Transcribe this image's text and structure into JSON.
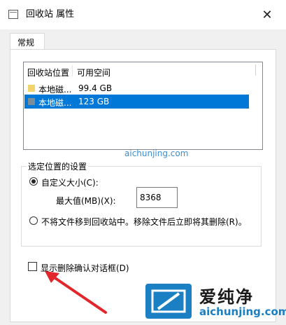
{
  "window": {
    "title": "回收站 属性",
    "close_glyph": "✕"
  },
  "tabs": [
    {
      "label": "常规"
    }
  ],
  "list": {
    "headers": [
      "回收站位置",
      "可用空间"
    ],
    "rows": [
      {
        "location": "本地磁...",
        "free": "99.4 GB",
        "selected": false
      },
      {
        "location": "本地磁...",
        "free": "123 GB",
        "selected": true
      }
    ]
  },
  "settings": {
    "group_title": "选定位置的设置",
    "custom_size_label": "自定义大小(C):",
    "max_size_label": "最大值(MB)(X):",
    "max_size_value": "8368",
    "no_move_label": "不将文件移到回收站中。移除文件后立即将其删除(R)。",
    "selected_option": "custom"
  },
  "confirm_dialog": {
    "label": "显示删除确认对话框(D)",
    "checked": false
  },
  "watermark": {
    "brand": "爱纯净",
    "url": "aichunjing.com"
  },
  "colors": {
    "accent": "#0078d7",
    "annotation_arrow": "#e3262c",
    "watermark_blue": "#1b7fc4"
  },
  "icons": {
    "window": "recycle-bin-icon",
    "drive": "folder-drive-icon",
    "close": "close-icon"
  }
}
